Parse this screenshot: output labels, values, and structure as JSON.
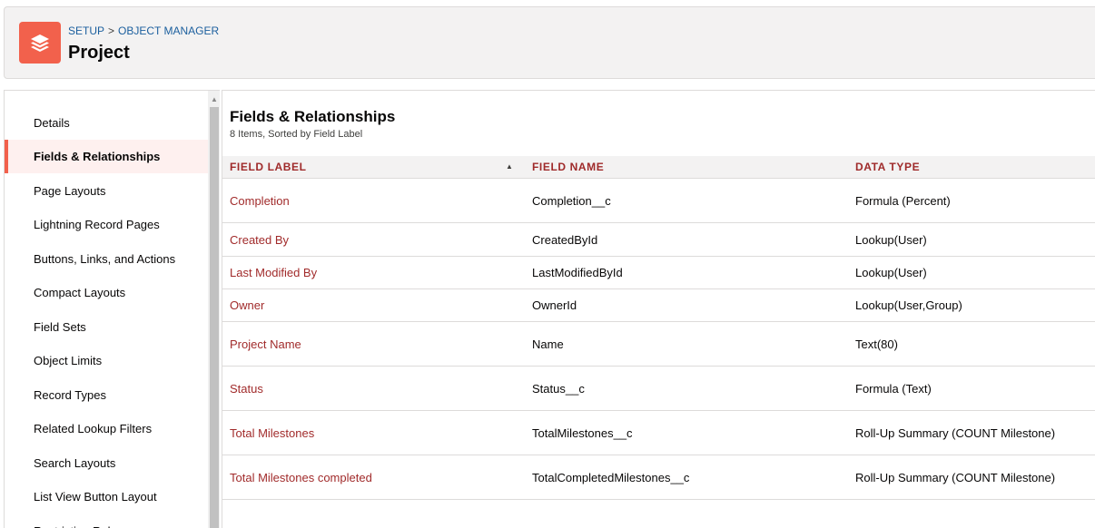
{
  "header": {
    "breadcrumbs": [
      "SETUP",
      "OBJECT MANAGER"
    ],
    "separator": ">",
    "title": "Project",
    "icon": "layers-icon",
    "icon_color": "#f2614c"
  },
  "sidebar": {
    "active_color": "#f2614c",
    "items": [
      {
        "label": "Details"
      },
      {
        "label": "Fields & Relationships",
        "active": true
      },
      {
        "label": "Page Layouts"
      },
      {
        "label": "Lightning Record Pages"
      },
      {
        "label": "Buttons, Links, and Actions"
      },
      {
        "label": "Compact Layouts"
      },
      {
        "label": "Field Sets"
      },
      {
        "label": "Object Limits"
      },
      {
        "label": "Record Types"
      },
      {
        "label": "Related Lookup Filters"
      },
      {
        "label": "Search Layouts"
      },
      {
        "label": "List View Button Layout"
      },
      {
        "label": "Restriction Rules"
      }
    ]
  },
  "main": {
    "title": "Fields & Relationships",
    "subtitle": "8 Items, Sorted by Field Label",
    "columns": [
      "FIELD LABEL",
      "FIELD NAME",
      "DATA TYPE"
    ],
    "sort_icon": "sort-ascending-icon",
    "rows": [
      {
        "label": "Completion",
        "name": "Completion__c",
        "type": "Formula (Percent)"
      },
      {
        "label": "Created By",
        "name": "CreatedById",
        "type": "Lookup(User)"
      },
      {
        "label": "Last Modified By",
        "name": "LastModifiedById",
        "type": "Lookup(User)"
      },
      {
        "label": "Owner",
        "name": "OwnerId",
        "type": "Lookup(User,Group)"
      },
      {
        "label": "Project Name",
        "name": "Name",
        "type": "Text(80)"
      },
      {
        "label": "Status",
        "name": "Status__c",
        "type": "Formula (Text)"
      },
      {
        "label": "Total Milestones",
        "name": "TotalMilestones__c",
        "type": "Roll-Up Summary (COUNT Milestone)"
      },
      {
        "label": "Total Milestones completed",
        "name": "TotalCompletedMilestones__c",
        "type": "Roll-Up Summary (COUNT Milestone)"
      }
    ]
  }
}
